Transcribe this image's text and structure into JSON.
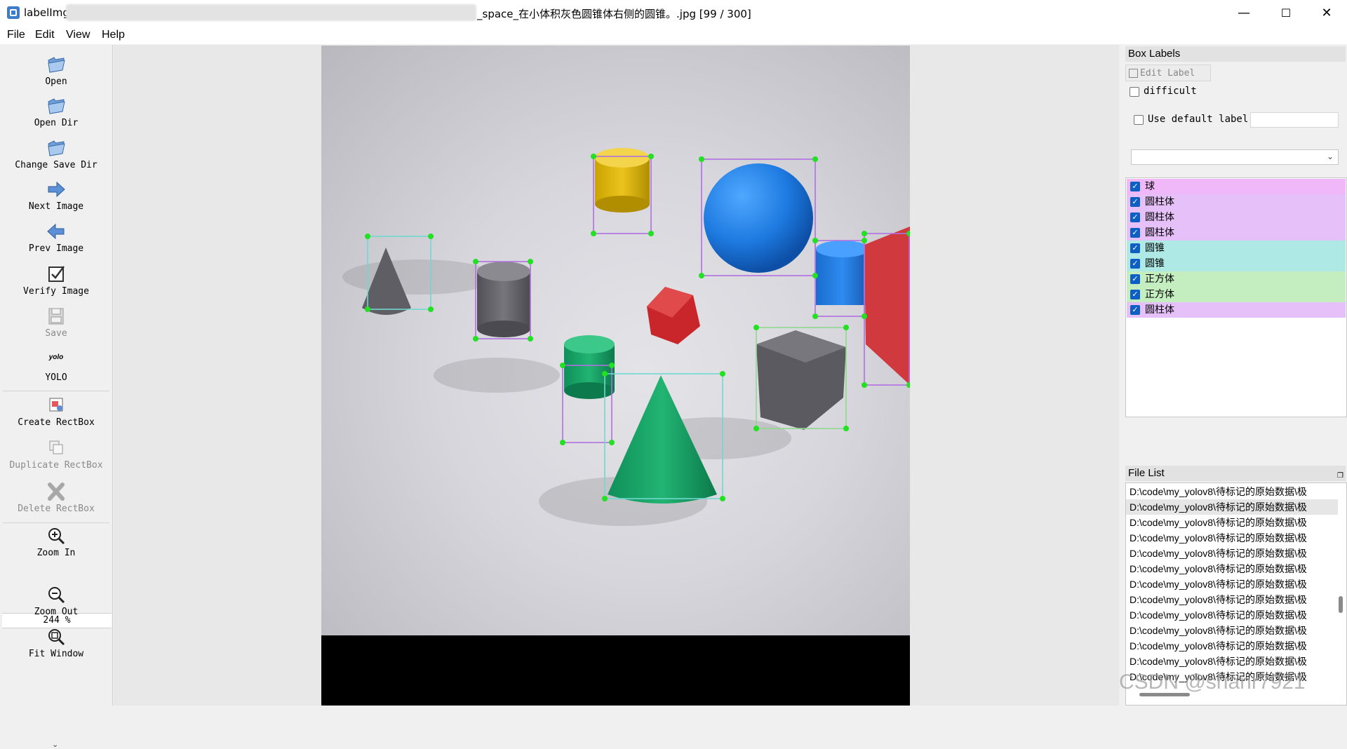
{
  "window": {
    "app_name": "labelImg",
    "title_suffix": "_space_在小体积灰色圆锥体右侧的圆锥。.jpg [99 / 300]",
    "minimize": "—",
    "maximize": "☐",
    "close": "✕"
  },
  "menu": [
    "File",
    "Edit",
    "View",
    "Help"
  ],
  "toolbar": {
    "open": "Open",
    "open_dir": "Open Dir",
    "change_save_dir": "Change Save Dir",
    "next_image": "Next Image",
    "prev_image": "Prev Image",
    "verify_image": "Verify Image",
    "save": "Save",
    "yolo_icon_text": "yolo",
    "yolo": "YOLO",
    "create_rectbox": "Create RectBox",
    "duplicate_rectbox": "Duplicate RectBox",
    "delete_rectbox": "Delete RectBox",
    "zoom_in": "Zoom In",
    "zoom_value": "244 %",
    "zoom_out": "Zoom Out",
    "fit_window": "Fit Window"
  },
  "box_labels": {
    "title": "Box Labels",
    "edit_label": "Edit Label",
    "difficult": "difficult",
    "use_default_label": "Use default label",
    "default_label_value": "",
    "combo_value": "",
    "items": [
      {
        "label": "球",
        "color": "#f0b8f8",
        "checked": true
      },
      {
        "label": "圆柱体",
        "color": "#e6c0f8",
        "checked": true
      },
      {
        "label": "圆柱体",
        "color": "#e6c0f8",
        "checked": true
      },
      {
        "label": "圆柱体",
        "color": "#e6c0f8",
        "checked": true
      },
      {
        "label": "圆锥",
        "color": "#aee9e6",
        "checked": true
      },
      {
        "label": "圆锥",
        "color": "#aee9e6",
        "checked": true
      },
      {
        "label": "正方体",
        "color": "#c4eec0",
        "checked": true
      },
      {
        "label": "正方体",
        "color": "#c4eec0",
        "checked": true
      },
      {
        "label": "圆柱体",
        "color": "#e6c0f8",
        "checked": true
      }
    ]
  },
  "file_list": {
    "title": "File List",
    "items": [
      "D:\\code\\my_yolov8\\待标记的原始数据\\极",
      "D:\\code\\my_yolov8\\待标记的原始数据\\极",
      "D:\\code\\my_yolov8\\待标记的原始数据\\极",
      "D:\\code\\my_yolov8\\待标记的原始数据\\极",
      "D:\\code\\my_yolov8\\待标记的原始数据\\极",
      "D:\\code\\my_yolov8\\待标记的原始数据\\极",
      "D:\\code\\my_yolov8\\待标记的原始数据\\极",
      "D:\\code\\my_yolov8\\待标记的原始数据\\极",
      "D:\\code\\my_yolov8\\待标记的原始数据\\极",
      "D:\\code\\my_yolov8\\待标记的原始数据\\极",
      "D:\\code\\my_yolov8\\待标记的原始数据\\极",
      "D:\\code\\my_yolov8\\待标记的原始数据\\极",
      "D:\\code\\my_yolov8\\待标记的原始数据\\极"
    ],
    "selected_index": 1
  },
  "watermark": "CSDN @shanr7921",
  "colors": {
    "handle": "#22e022",
    "box_ball": "#b070e0",
    "box_cylinder": "#b070e0",
    "box_cone": "#70d8d0",
    "box_cube": "#90d890",
    "checkbox": "#0e5fc4"
  }
}
